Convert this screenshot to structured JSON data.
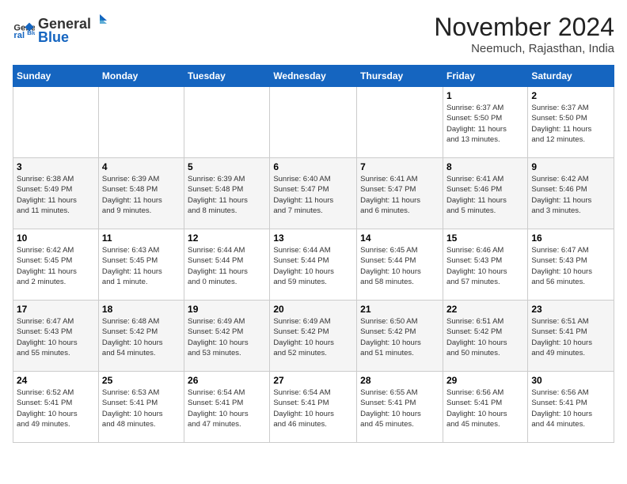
{
  "logo": {
    "line1": "General",
    "line2": "Blue"
  },
  "title": "November 2024",
  "subtitle": "Neemuch, Rajasthan, India",
  "days_of_week": [
    "Sunday",
    "Monday",
    "Tuesday",
    "Wednesday",
    "Thursday",
    "Friday",
    "Saturday"
  ],
  "weeks": [
    [
      {
        "day": "",
        "info": ""
      },
      {
        "day": "",
        "info": ""
      },
      {
        "day": "",
        "info": ""
      },
      {
        "day": "",
        "info": ""
      },
      {
        "day": "",
        "info": ""
      },
      {
        "day": "1",
        "info": "Sunrise: 6:37 AM\nSunset: 5:50 PM\nDaylight: 11 hours\nand 13 minutes."
      },
      {
        "day": "2",
        "info": "Sunrise: 6:37 AM\nSunset: 5:50 PM\nDaylight: 11 hours\nand 12 minutes."
      }
    ],
    [
      {
        "day": "3",
        "info": "Sunrise: 6:38 AM\nSunset: 5:49 PM\nDaylight: 11 hours\nand 11 minutes."
      },
      {
        "day": "4",
        "info": "Sunrise: 6:39 AM\nSunset: 5:48 PM\nDaylight: 11 hours\nand 9 minutes."
      },
      {
        "day": "5",
        "info": "Sunrise: 6:39 AM\nSunset: 5:48 PM\nDaylight: 11 hours\nand 8 minutes."
      },
      {
        "day": "6",
        "info": "Sunrise: 6:40 AM\nSunset: 5:47 PM\nDaylight: 11 hours\nand 7 minutes."
      },
      {
        "day": "7",
        "info": "Sunrise: 6:41 AM\nSunset: 5:47 PM\nDaylight: 11 hours\nand 6 minutes."
      },
      {
        "day": "8",
        "info": "Sunrise: 6:41 AM\nSunset: 5:46 PM\nDaylight: 11 hours\nand 5 minutes."
      },
      {
        "day": "9",
        "info": "Sunrise: 6:42 AM\nSunset: 5:46 PM\nDaylight: 11 hours\nand 3 minutes."
      }
    ],
    [
      {
        "day": "10",
        "info": "Sunrise: 6:42 AM\nSunset: 5:45 PM\nDaylight: 11 hours\nand 2 minutes."
      },
      {
        "day": "11",
        "info": "Sunrise: 6:43 AM\nSunset: 5:45 PM\nDaylight: 11 hours\nand 1 minute."
      },
      {
        "day": "12",
        "info": "Sunrise: 6:44 AM\nSunset: 5:44 PM\nDaylight: 11 hours\nand 0 minutes."
      },
      {
        "day": "13",
        "info": "Sunrise: 6:44 AM\nSunset: 5:44 PM\nDaylight: 10 hours\nand 59 minutes."
      },
      {
        "day": "14",
        "info": "Sunrise: 6:45 AM\nSunset: 5:44 PM\nDaylight: 10 hours\nand 58 minutes."
      },
      {
        "day": "15",
        "info": "Sunrise: 6:46 AM\nSunset: 5:43 PM\nDaylight: 10 hours\nand 57 minutes."
      },
      {
        "day": "16",
        "info": "Sunrise: 6:47 AM\nSunset: 5:43 PM\nDaylight: 10 hours\nand 56 minutes."
      }
    ],
    [
      {
        "day": "17",
        "info": "Sunrise: 6:47 AM\nSunset: 5:43 PM\nDaylight: 10 hours\nand 55 minutes."
      },
      {
        "day": "18",
        "info": "Sunrise: 6:48 AM\nSunset: 5:42 PM\nDaylight: 10 hours\nand 54 minutes."
      },
      {
        "day": "19",
        "info": "Sunrise: 6:49 AM\nSunset: 5:42 PM\nDaylight: 10 hours\nand 53 minutes."
      },
      {
        "day": "20",
        "info": "Sunrise: 6:49 AM\nSunset: 5:42 PM\nDaylight: 10 hours\nand 52 minutes."
      },
      {
        "day": "21",
        "info": "Sunrise: 6:50 AM\nSunset: 5:42 PM\nDaylight: 10 hours\nand 51 minutes."
      },
      {
        "day": "22",
        "info": "Sunrise: 6:51 AM\nSunset: 5:42 PM\nDaylight: 10 hours\nand 50 minutes."
      },
      {
        "day": "23",
        "info": "Sunrise: 6:51 AM\nSunset: 5:41 PM\nDaylight: 10 hours\nand 49 minutes."
      }
    ],
    [
      {
        "day": "24",
        "info": "Sunrise: 6:52 AM\nSunset: 5:41 PM\nDaylight: 10 hours\nand 49 minutes."
      },
      {
        "day": "25",
        "info": "Sunrise: 6:53 AM\nSunset: 5:41 PM\nDaylight: 10 hours\nand 48 minutes."
      },
      {
        "day": "26",
        "info": "Sunrise: 6:54 AM\nSunset: 5:41 PM\nDaylight: 10 hours\nand 47 minutes."
      },
      {
        "day": "27",
        "info": "Sunrise: 6:54 AM\nSunset: 5:41 PM\nDaylight: 10 hours\nand 46 minutes."
      },
      {
        "day": "28",
        "info": "Sunrise: 6:55 AM\nSunset: 5:41 PM\nDaylight: 10 hours\nand 45 minutes."
      },
      {
        "day": "29",
        "info": "Sunrise: 6:56 AM\nSunset: 5:41 PM\nDaylight: 10 hours\nand 45 minutes."
      },
      {
        "day": "30",
        "info": "Sunrise: 6:56 AM\nSunset: 5:41 PM\nDaylight: 10 hours\nand 44 minutes."
      }
    ]
  ]
}
